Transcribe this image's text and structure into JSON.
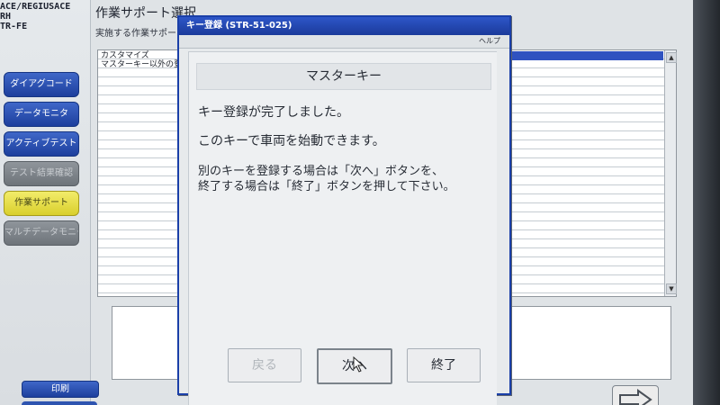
{
  "vehicle": {
    "line1": "ACE/REGIUSACE",
    "line2": "RH",
    "line3": "TR-FE"
  },
  "sidebar": {
    "items": [
      {
        "label": "ダイアグコード",
        "state": "active"
      },
      {
        "label": "データモニタ",
        "state": "active"
      },
      {
        "label": "アクティブテスト",
        "state": "active"
      },
      {
        "label": "テスト結果確認",
        "state": "disabled"
      },
      {
        "label": "作業サポート",
        "state": "selected"
      },
      {
        "label": "マルチデータモニタ",
        "state": "disabled"
      }
    ],
    "print_label": "印刷"
  },
  "main": {
    "title": "作業サポート選択",
    "subtitle": "実施する作業サポート",
    "list": [
      "カスタマイズ",
      "マスターキー以外の登"
    ]
  },
  "dialog": {
    "title": "キー登録 (STR-51-025)",
    "help": "ヘルプ",
    "header": "マスターキー",
    "message1": "キー登録が完了しました。",
    "message2": "このキーで車両を始動できます。",
    "message3": "別のキーを登録する場合は「次へ」ボタンを、",
    "message4": "終了する場合は「終了」ボタンを押して下さい。",
    "buttons": {
      "back": "戻る",
      "next": "次へ",
      "finish": "終了"
    }
  },
  "colors": {
    "accent_blue": "#2d56c8",
    "selected_yellow": "#e6df4a",
    "disabled_gray": "#7f858b"
  }
}
